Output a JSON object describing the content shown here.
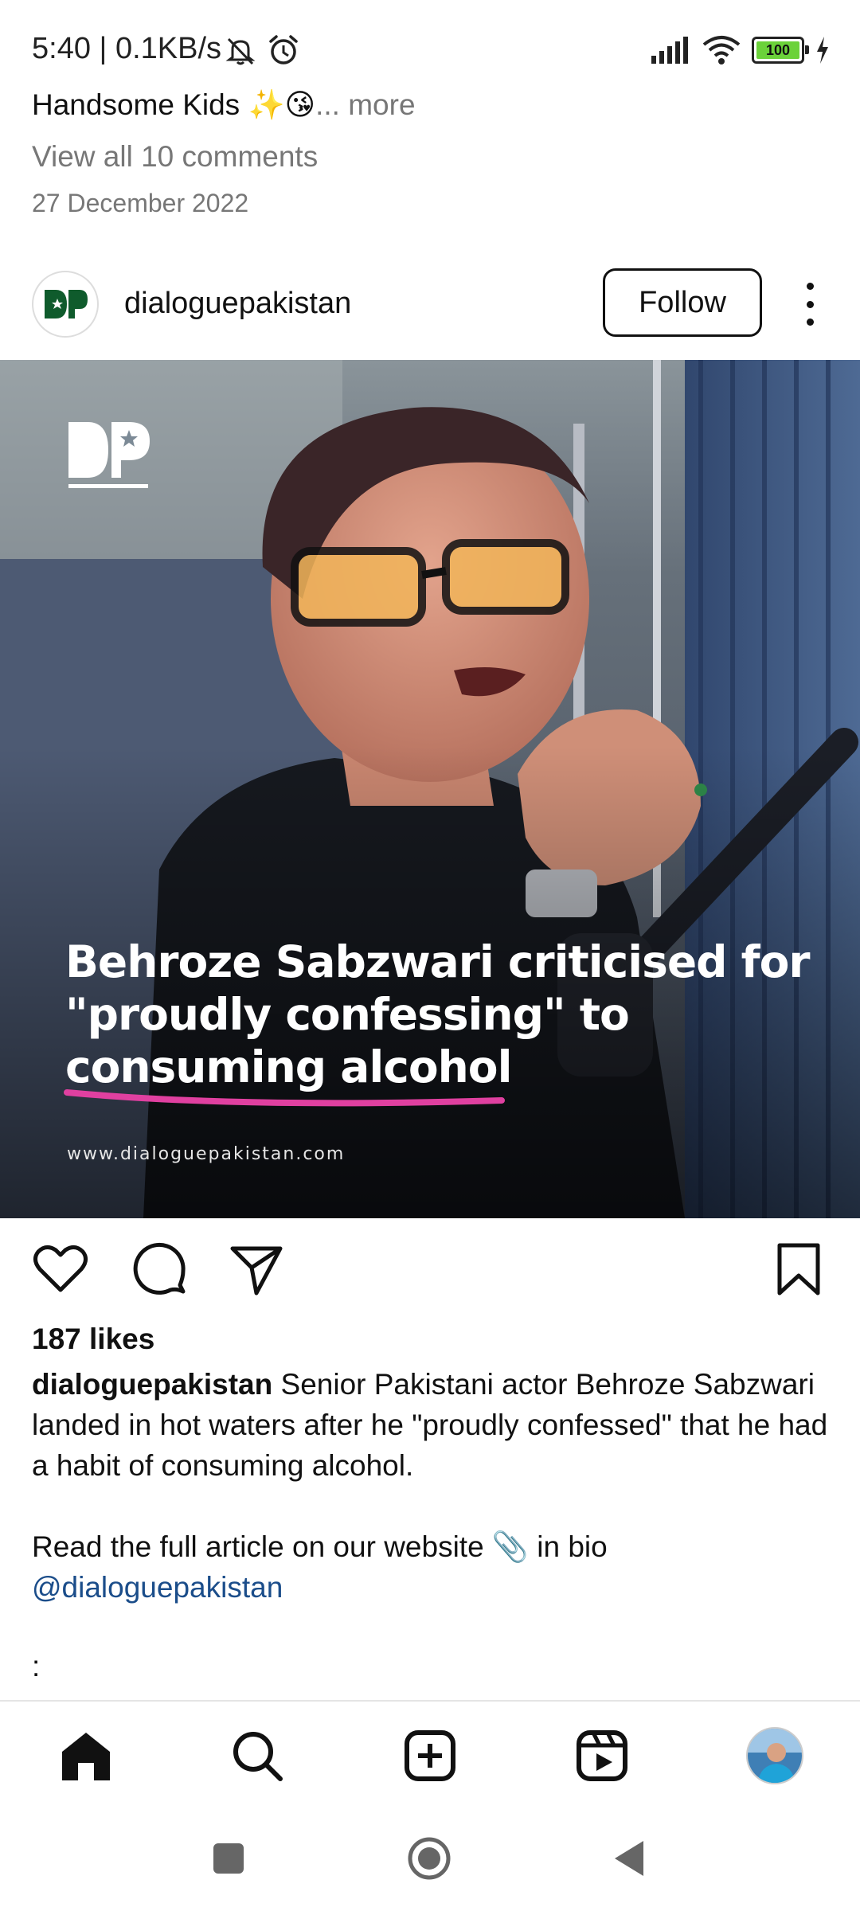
{
  "status_bar": {
    "time": "5:40 | 0.1KB/s",
    "battery": "100",
    "icons": [
      "mute-icon",
      "alarm-icon",
      "signal-icon",
      "wifi-icon",
      "battery-icon",
      "charging-icon"
    ]
  },
  "previous_post": {
    "caption_text": "Handsome Kids ✨😘",
    "more_label": "... more",
    "view_comments": "View all 10 comments",
    "date": "27 December 2022"
  },
  "post": {
    "username": "dialoguepakistan",
    "follow_label": "Follow",
    "image": {
      "logo_text": "DP",
      "headline_lines": [
        "Behroze Sabzwari criticised for",
        "\"proudly confessing\" to",
        "consuming alcohol"
      ],
      "website": "www.dialoguepakistan.com"
    },
    "likes": "187 likes",
    "caption": {
      "username": "dialoguepakistan",
      "text": " Senior Pakistani actor Behroze Sabzwari landed in hot waters after he \"proudly confessed\" that he had a habit of consuming alcohol.",
      "line2": "Read the full article on our website 📎 in bio",
      "mention": "@dialoguepakistan",
      "trailing": ":"
    }
  },
  "bottom_nav": [
    "home-icon",
    "search-icon",
    "create-icon",
    "reels-icon",
    "profile-avatar"
  ],
  "colors": {
    "follow_border": "#111111",
    "mention": "#1b4d8a",
    "battery_fill": "#6bd23a",
    "headline_underline": "#e040a0"
  }
}
